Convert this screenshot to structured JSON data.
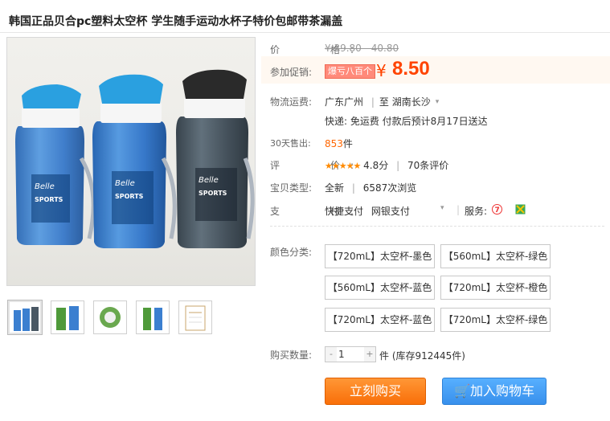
{
  "title": "韩国正品贝合pc塑料太空杯 学生随手运动水杯子特价包邮带茶漏盖",
  "price": {
    "label": "价　　格:",
    "original": "¥ 39.80 - 40.80"
  },
  "promo": {
    "label": "参加促销:",
    "badge": "爆亏八百个",
    "currency": "¥",
    "price": "8.50"
  },
  "shipping": {
    "label": "物流运费:",
    "from": "广东广州",
    "sep": "|",
    "to_prefix": "至",
    "to": "湖南长沙",
    "detail": "快递: 免运费 付款后预计8月17日送达"
  },
  "sold30": {
    "label": "30天售出:",
    "count": "853",
    "unit": "件"
  },
  "rating": {
    "label": "评　　价:",
    "stars": "★★★★★",
    "score": "4.8分",
    "reviews": "70条评价"
  },
  "status": {
    "label": "宝贝类型:",
    "condition": "全新",
    "views": "6587次浏览"
  },
  "payment": {
    "label": "支　　付:",
    "method1": "快捷支付",
    "method2": "网银支付",
    "service_label": "服务:"
  },
  "sku": {
    "label": "颜色分类:",
    "options": [
      "【720mL】太空杯-墨色",
      "【560mL】太空杯-绿色",
      "【560mL】太空杯-蓝色",
      "【720mL】太空杯-橙色",
      "【720mL】太空杯-蓝色",
      "【720mL】太空杯-绿色"
    ]
  },
  "quantity": {
    "label": "购买数量:",
    "value": "1",
    "minus": "-",
    "plus": "+",
    "stock": "件 (库存912445件)"
  },
  "buttons": {
    "buy_now": "立刻购买",
    "add_cart": "加入购物车"
  },
  "icons": {
    "cart": "cart-icon",
    "service1": "tmall-service-icon",
    "service2": "guarantee-icon"
  }
}
